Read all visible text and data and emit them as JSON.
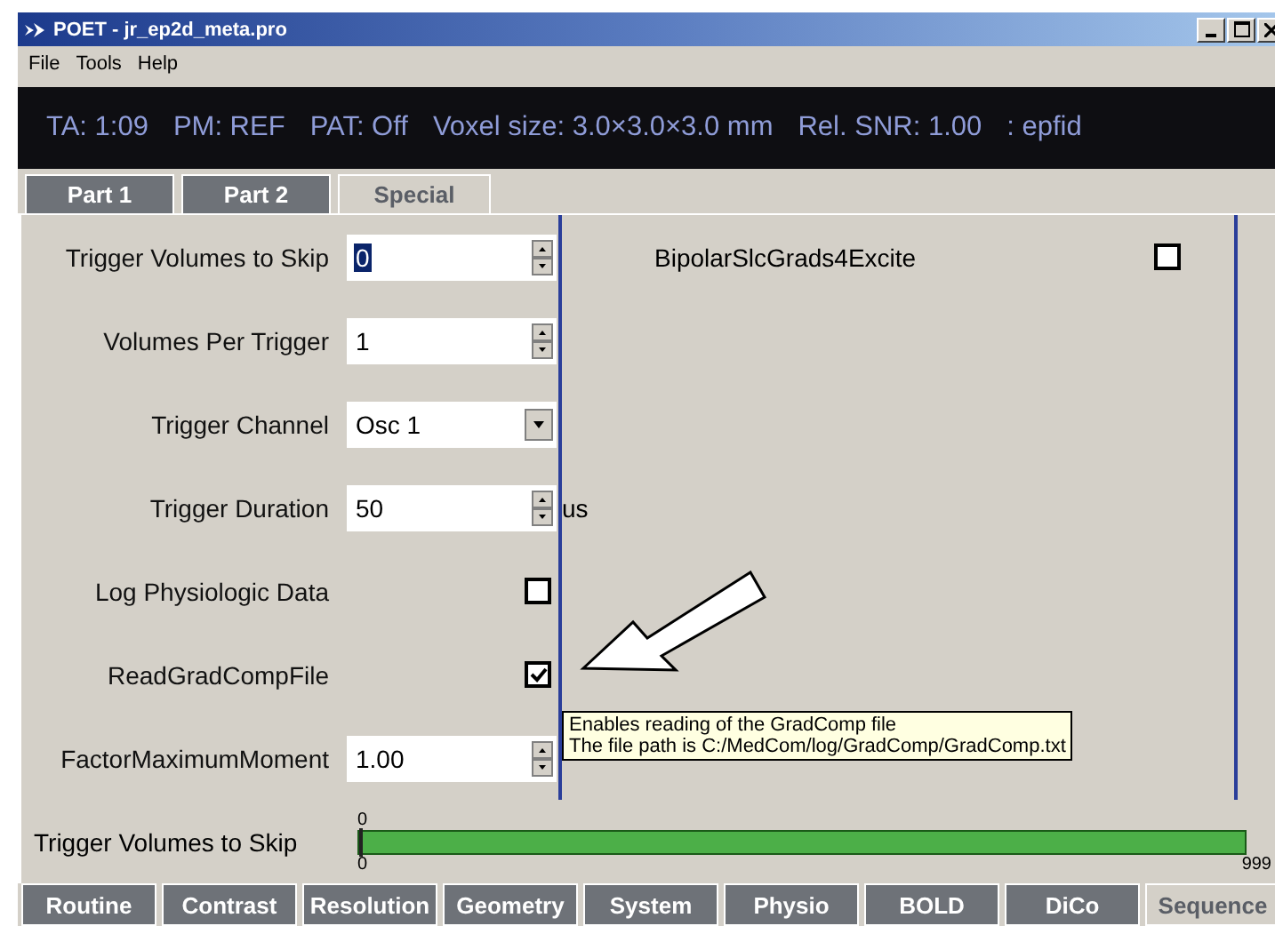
{
  "window": {
    "title": "POET - jr_ep2d_meta.pro"
  },
  "menu": [
    "File",
    "Tools",
    "Help"
  ],
  "status_bar": [
    "TA: 1:09",
    "PM: REF",
    "PAT: Off",
    "Voxel size: 3.0×3.0×3.0 mm",
    "Rel. SNR: 1.00",
    ": epfid"
  ],
  "tabs": [
    {
      "label": "Part 1",
      "selected": false
    },
    {
      "label": "Part 2",
      "selected": false
    },
    {
      "label": "Special",
      "selected": true
    }
  ],
  "parameters": [
    {
      "kind": "spin",
      "label": "Trigger Volumes to Skip",
      "value": "0",
      "focused": true
    },
    {
      "kind": "spin",
      "label": "Volumes Per Trigger",
      "value": "1",
      "focused": false
    },
    {
      "kind": "dropdown",
      "label": "Trigger Channel",
      "value": "Osc 1"
    },
    {
      "kind": "spin",
      "label": "Trigger Duration",
      "value": "50",
      "unit": "us",
      "focused": false
    },
    {
      "kind": "checkbox",
      "label": "Log Physiologic Data",
      "checked": false
    },
    {
      "kind": "checkbox",
      "label": "ReadGradCompFile",
      "checked": true
    },
    {
      "kind": "spin",
      "label": "FactorMaximumMoment",
      "value": "1.00",
      "focused": false
    }
  ],
  "right_parameters": [
    {
      "kind": "checkbox",
      "label": "BipolarSlcGrads4Excite",
      "checked": false
    }
  ],
  "tooltip": {
    "lines": [
      "Enables reading of the GradComp file",
      "The file path is C:/MedCom/log/GradComp/GradComp.txt"
    ]
  },
  "slider": {
    "label": "Trigger Volumes to Skip",
    "value": "0",
    "min": "0",
    "max": "999",
    "level": 0
  },
  "bottom_tabs": [
    {
      "label": "Routine",
      "selected": false
    },
    {
      "label": "Contrast",
      "selected": false
    },
    {
      "label": "Resolution",
      "selected": false
    },
    {
      "label": "Geometry",
      "selected": false
    },
    {
      "label": "System",
      "selected": false
    },
    {
      "label": "Physio",
      "selected": false
    },
    {
      "label": "BOLD",
      "selected": false
    },
    {
      "label": "DiCo",
      "selected": false
    },
    {
      "label": "Sequence",
      "selected": true
    }
  ]
}
